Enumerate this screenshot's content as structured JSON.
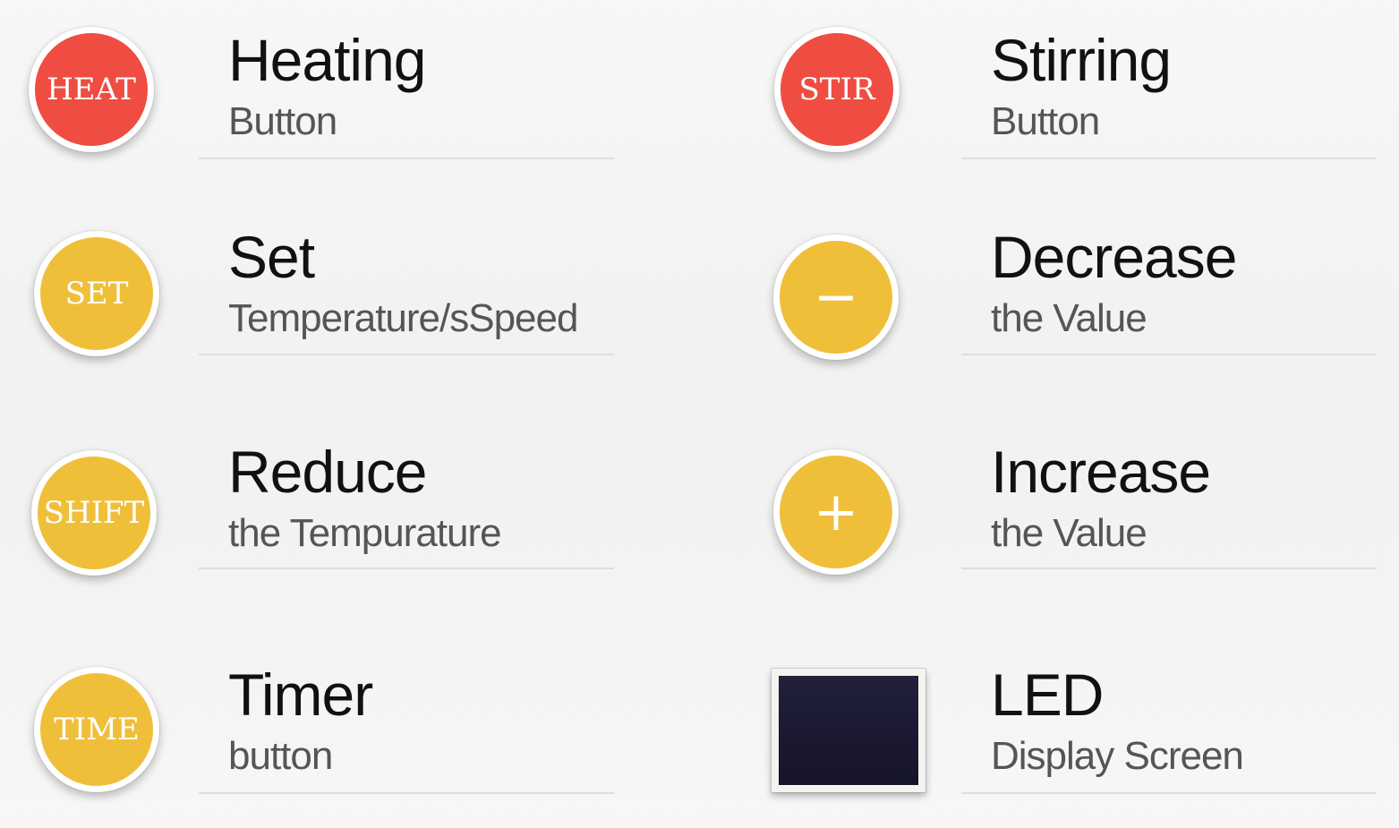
{
  "colors": {
    "red": "#ef4d41",
    "yellow": "#f0bf3a",
    "led_screen": "#1a1930",
    "title_text": "#111111",
    "subtitle_text": "#555555"
  },
  "left": [
    {
      "badge": "HEAT",
      "title": "Heating",
      "subtitle": "Button"
    },
    {
      "badge": "SET",
      "title": "Set",
      "subtitle": "Temperature/sSpeed"
    },
    {
      "badge": "SHIFT",
      "title": "Reduce",
      "subtitle": "the Tempurature"
    },
    {
      "badge": "TIME",
      "title": "Timer",
      "subtitle": "button"
    }
  ],
  "right": [
    {
      "badge": "STIR",
      "title": "Stirring",
      "subtitle": "Button"
    },
    {
      "badge": "−",
      "title": "Decrease",
      "subtitle": "the Value"
    },
    {
      "badge": "+",
      "title": "Increase",
      "subtitle": "the Value"
    },
    {
      "badge": "",
      "title": "LED",
      "subtitle": "Display Screen"
    }
  ]
}
